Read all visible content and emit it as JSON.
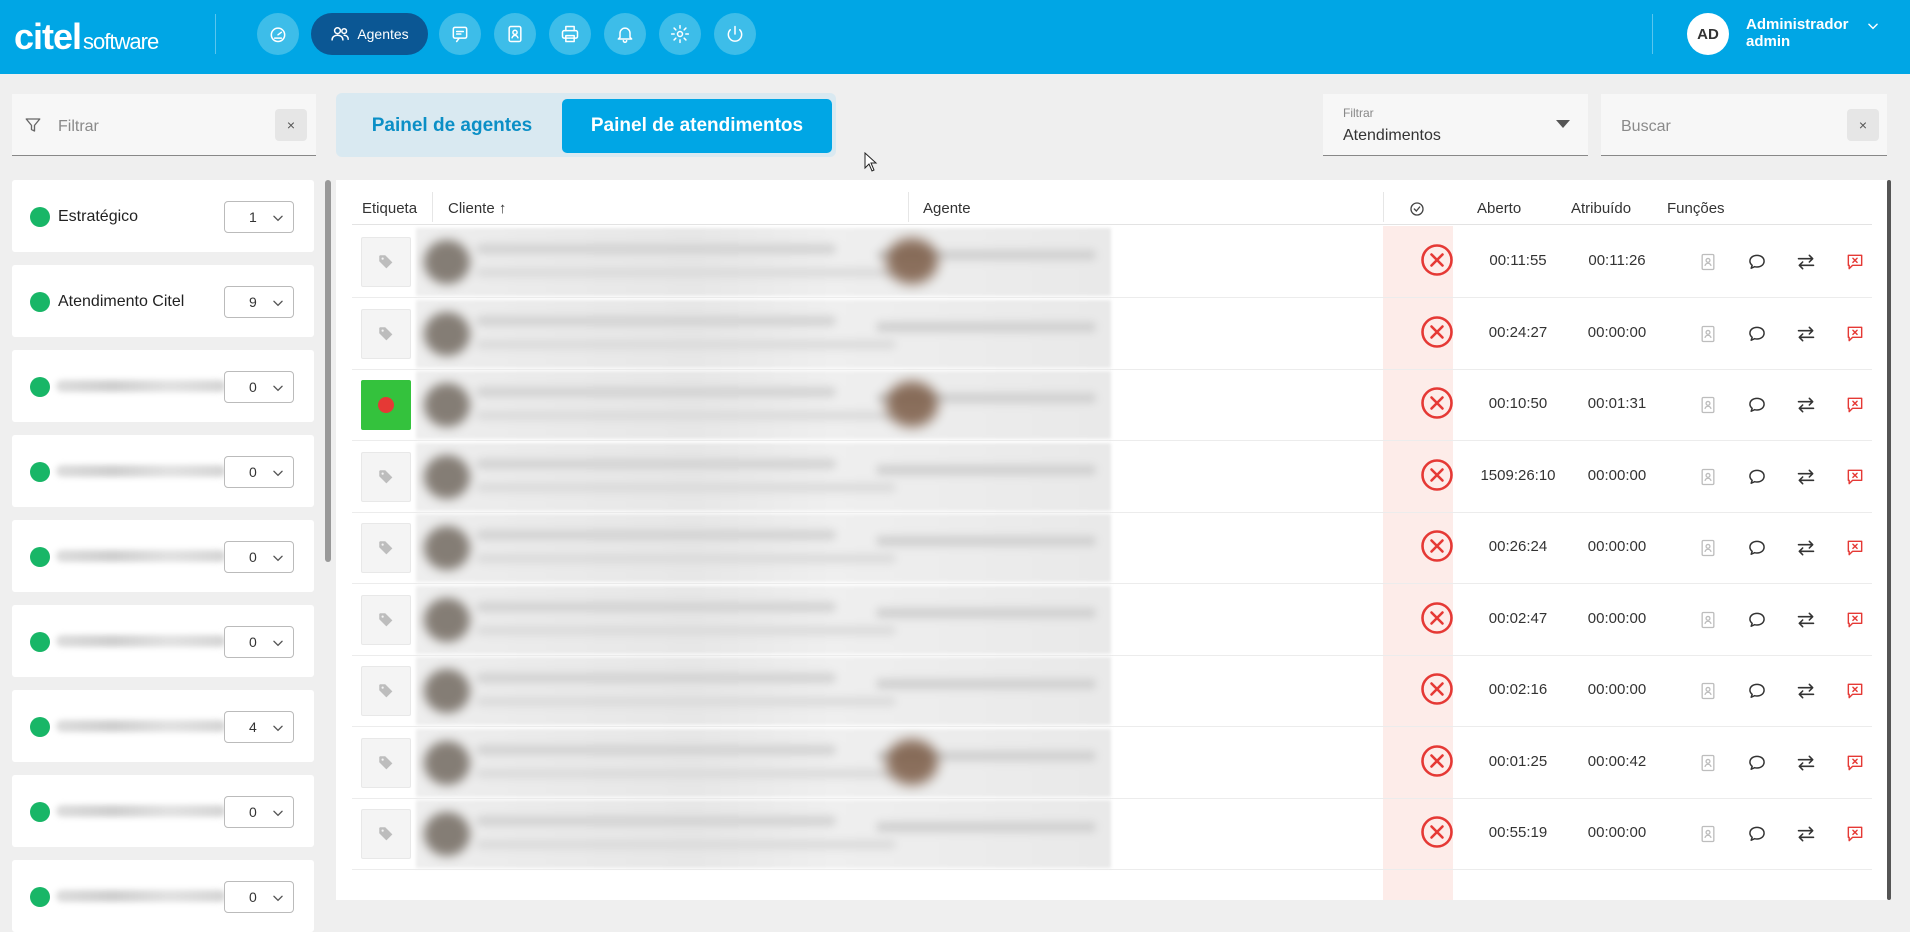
{
  "header": {
    "logo_main": "citel",
    "logo_sub": "software",
    "nav": [
      {
        "name": "dashboard",
        "icon": "gauge-icon"
      },
      {
        "name": "agentes",
        "icon": "users-icon",
        "label": "Agentes",
        "active": true
      },
      {
        "name": "chat",
        "icon": "message-icon"
      },
      {
        "name": "contacts",
        "icon": "contact-book-icon"
      },
      {
        "name": "print",
        "icon": "printer-icon"
      },
      {
        "name": "notifications",
        "icon": "bell-icon"
      },
      {
        "name": "settings",
        "icon": "gear-icon"
      },
      {
        "name": "logout",
        "icon": "power-icon"
      }
    ],
    "user": {
      "initials": "AD",
      "name": "Administrador",
      "role": "admin"
    }
  },
  "sidebar": {
    "filter_placeholder": "Filtrar",
    "clear": "×",
    "queues": [
      {
        "name": "Estratégico",
        "count": "1"
      },
      {
        "name": "Atendimento Citel",
        "count": "9"
      },
      {
        "name": "",
        "count": "0"
      },
      {
        "name": "",
        "count": "0"
      },
      {
        "name": "",
        "count": "0"
      },
      {
        "name": "",
        "count": "0"
      },
      {
        "name": "",
        "count": "4"
      },
      {
        "name": "",
        "count": "0"
      },
      {
        "name": "",
        "count": "0"
      }
    ]
  },
  "tabs": {
    "agents": "Painel de agentes",
    "attendances": "Painel de atendimentos"
  },
  "toolbar": {
    "filter_label": "Filtrar",
    "filter_value": "Atendimentos",
    "search_placeholder": "Buscar",
    "clear": "×"
  },
  "table": {
    "headers": {
      "tag": "Etiqueta",
      "client": "Cliente ↑",
      "agent": "Agente",
      "opened": "Aberto",
      "assigned": "Atribuído",
      "functions": "Funções"
    },
    "rows": [
      {
        "tag": "none",
        "opened": "00:11:55",
        "assigned": "00:11:26",
        "agent_face": true
      },
      {
        "tag": "none",
        "opened": "00:24:27",
        "assigned": "00:00:00",
        "agent_face": false
      },
      {
        "tag": "green",
        "opened": "00:10:50",
        "assigned": "00:01:31",
        "agent_face": true
      },
      {
        "tag": "none",
        "opened": "1509:26:10",
        "assigned": "00:00:00",
        "agent_face": false
      },
      {
        "tag": "none",
        "opened": "00:26:24",
        "assigned": "00:00:00",
        "agent_face": false
      },
      {
        "tag": "none",
        "opened": "00:02:47",
        "assigned": "00:00:00",
        "agent_face": false
      },
      {
        "tag": "none",
        "opened": "00:02:16",
        "assigned": "00:00:00",
        "agent_face": false
      },
      {
        "tag": "none",
        "opened": "00:01:25",
        "assigned": "00:00:42",
        "agent_face": true
      },
      {
        "tag": "none",
        "opened": "00:55:19",
        "assigned": "00:00:00",
        "agent_face": false
      }
    ]
  },
  "colors": {
    "brand": "#00a6e5",
    "nav_active": "#0b5794",
    "online": "#18b667",
    "danger": "#e53935",
    "status_bg": "#fdece9"
  }
}
